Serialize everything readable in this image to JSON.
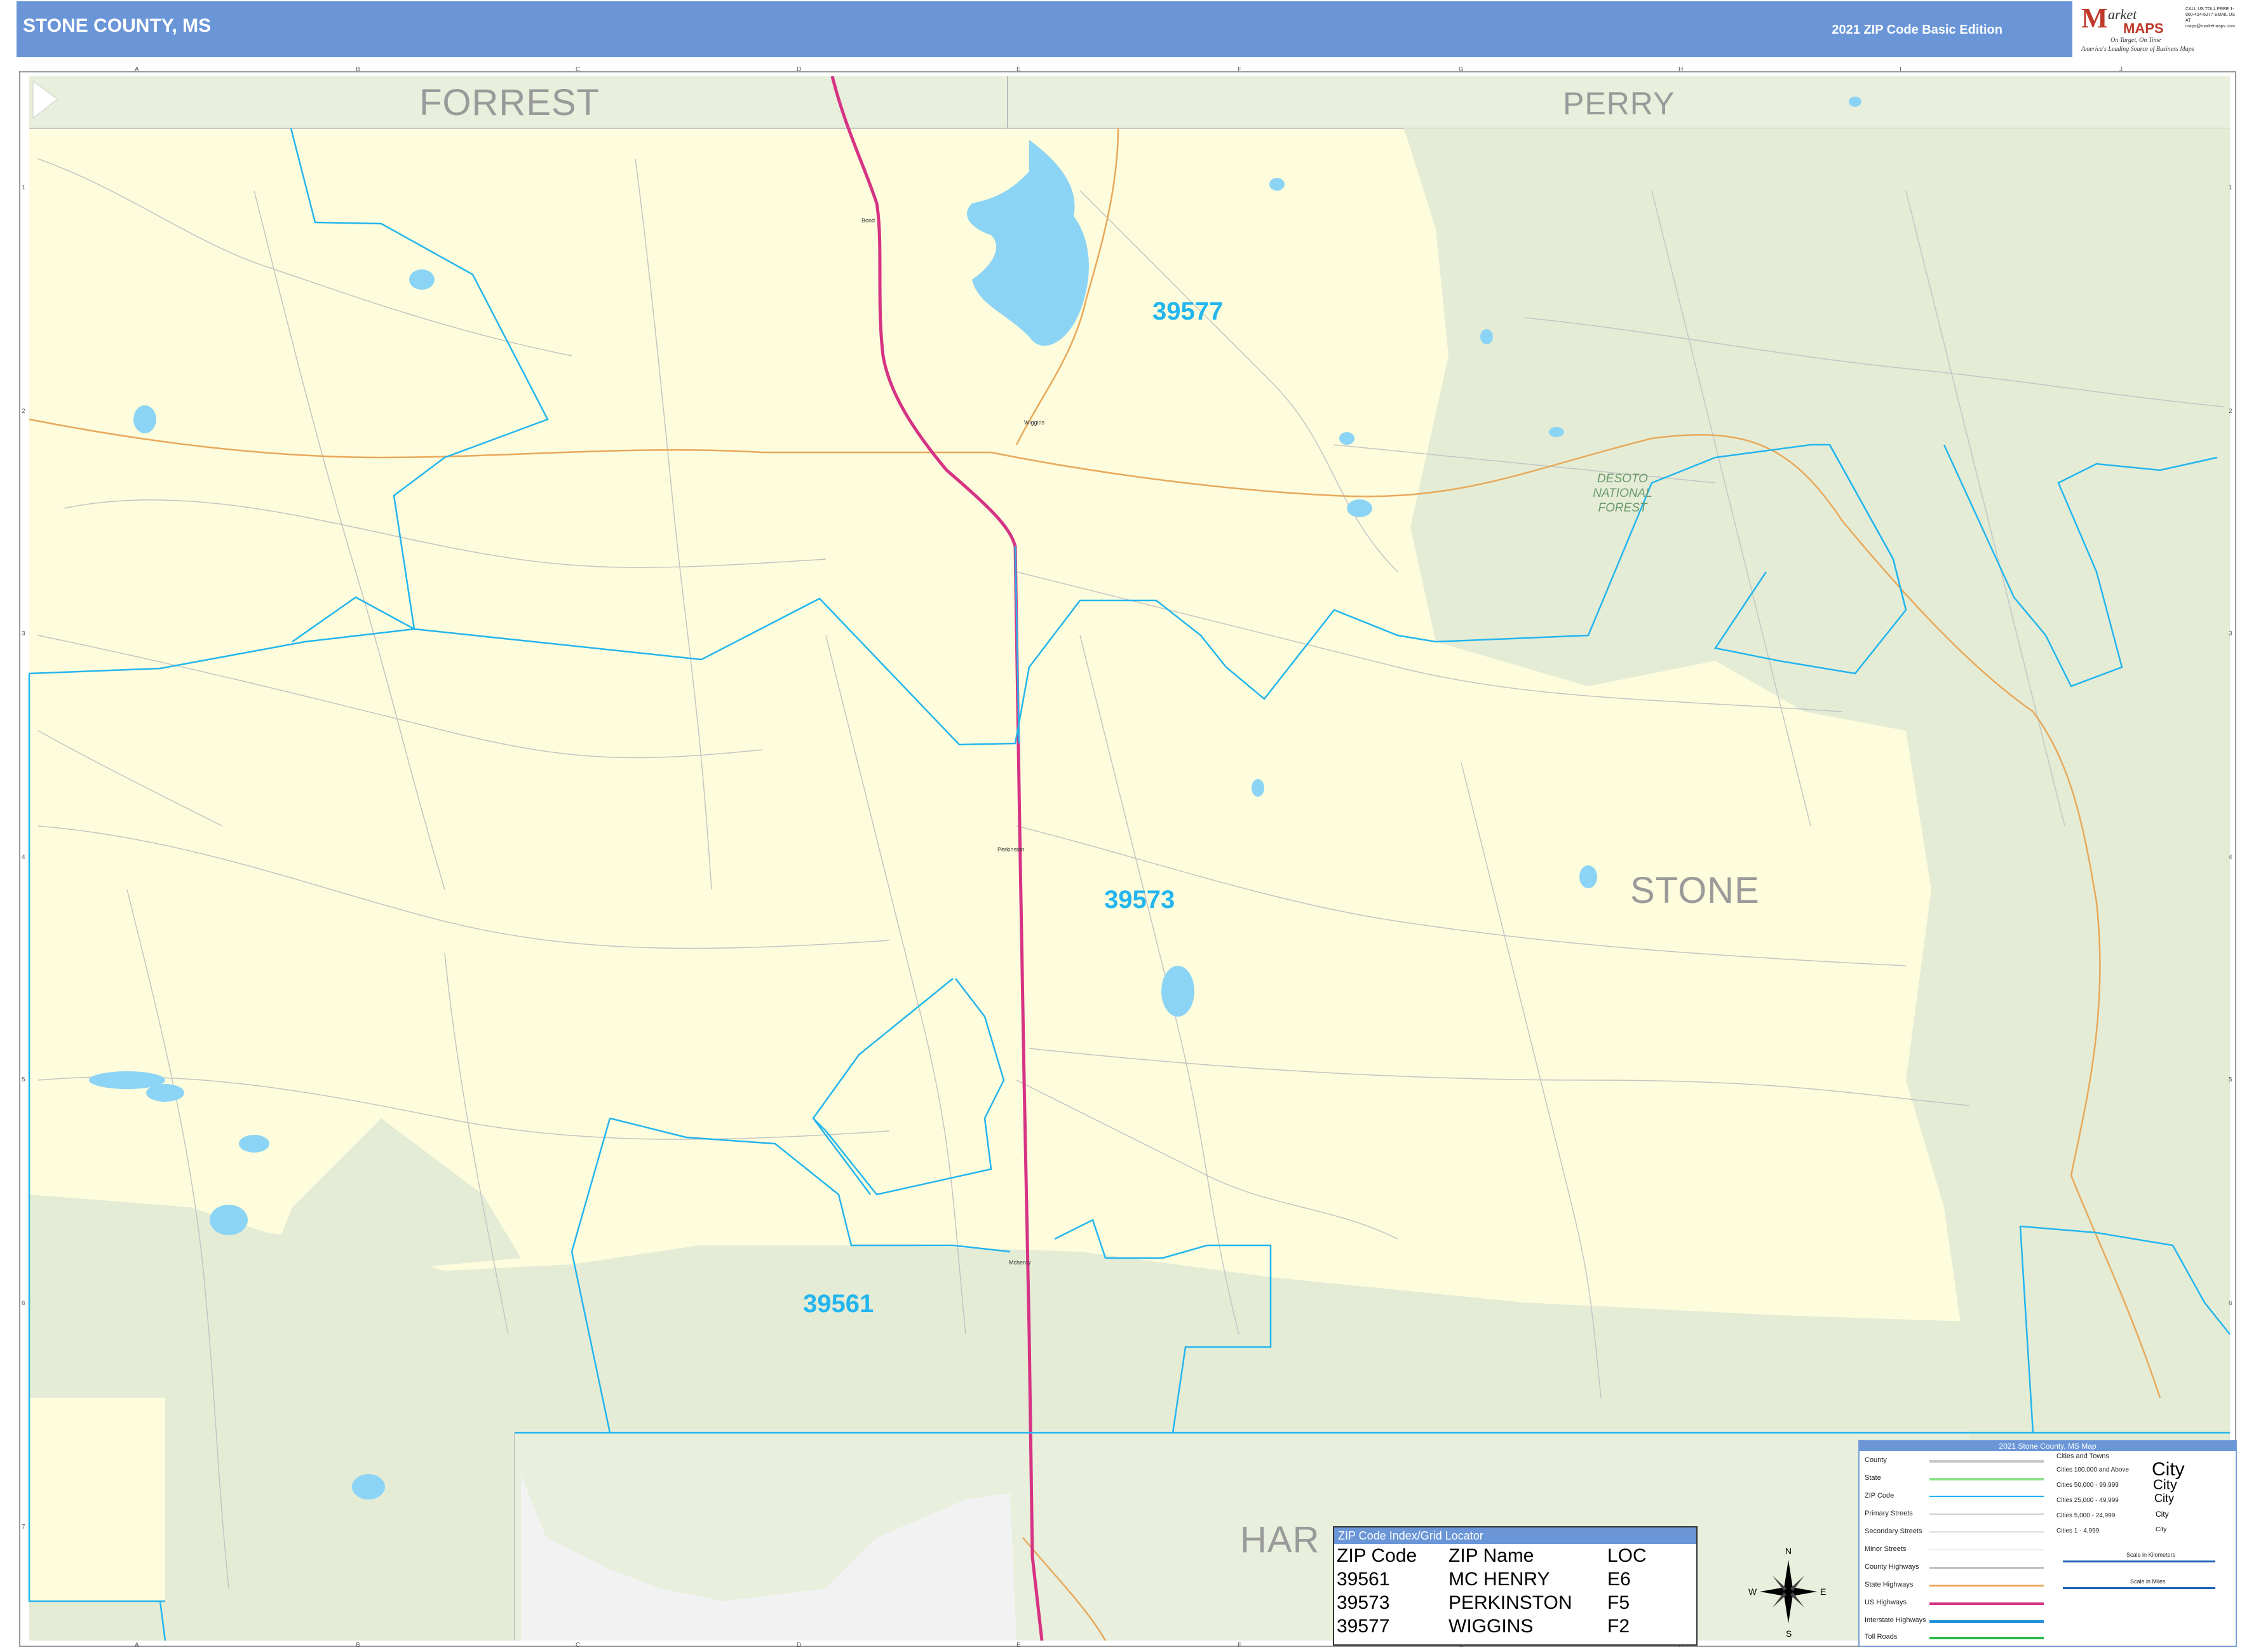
{
  "header": {
    "title": "STONE COUNTY, MS",
    "edition": "2021 ZIP Code Basic Edition"
  },
  "logo": {
    "m": "M",
    "arket": "arket",
    "maps": "MAPS",
    "tagline1": "On Target, On Time",
    "tagline2": "America's Leading Source of Business Maps",
    "contact": "CALL US TOLL FREE 1-800-424-6277 EMAIL US AT maps@marketmaps.com"
  },
  "grid": {
    "letters": [
      "A",
      "B",
      "C",
      "D",
      "E",
      "F",
      "G",
      "H",
      "I",
      "J"
    ],
    "numbers": [
      "1",
      "2",
      "3",
      "4",
      "5",
      "6",
      "7"
    ]
  },
  "counties": {
    "forrest": "FORREST",
    "perry": "PERRY",
    "stone": "STONE",
    "harrison_partial": "HAR"
  },
  "zip_labels": {
    "z39577": "39577",
    "z39573": "39573",
    "z39561": "39561"
  },
  "forest": {
    "line1": "DESOTO",
    "line2": "NATIONAL",
    "line3": "FOREST"
  },
  "towns": {
    "wiggins": "Wiggins",
    "perkinston": "Perkinston",
    "mchenry": "Mchenry",
    "bond": "Bond"
  },
  "zip_index": {
    "title": "ZIP Code Index/Grid Locator",
    "columns": [
      "ZIP Code",
      "ZIP Name",
      "LOC"
    ],
    "rows": [
      [
        "39561",
        "MC HENRY",
        "E6"
      ],
      [
        "39573",
        "PERKINSTON",
        "F5"
      ],
      [
        "39577",
        "WIGGINS",
        "F2"
      ]
    ]
  },
  "legend": {
    "title": "2021 Stone County, MS Map",
    "lines": [
      {
        "label": "County",
        "color": "#c8c8c8"
      },
      {
        "label": "State",
        "color": "#8be08b"
      },
      {
        "label": "ZIP Code",
        "color": "#23b5ee"
      },
      {
        "label": "Primary Streets",
        "color": "#d0d0d0"
      },
      {
        "label": "Secondary Streets",
        "color": "#dddddd"
      },
      {
        "label": "Minor Streets",
        "color": "#eeeeee"
      },
      {
        "label": "County Highways",
        "color": "#c0c0c0"
      },
      {
        "label": "State Highways",
        "color": "#e8a85a"
      },
      {
        "label": "US Highways",
        "color": "#d63384"
      },
      {
        "label": "Interstate Highways",
        "color": "#1a8cd8"
      },
      {
        "label": "Toll Roads",
        "color": "#2bb84a"
      }
    ],
    "cities_title": "Cities and Towns",
    "cities": [
      "Cities 100,000 and Above",
      "Cities 50,000 - 99,999",
      "Cities 25,000 - 49,999",
      "Cities 5,000 - 24,999",
      "Cities 1 - 4,999"
    ],
    "city_word": "City",
    "scale_km": "Scale in Kilometers",
    "scale_mi": "Scale in Miles"
  },
  "compass": {
    "n": "N",
    "s": "S",
    "e": "E",
    "w": "W"
  },
  "colors": {
    "header": "#6a96d8",
    "stone_fill": "#fdfcdc",
    "forest_fill": "#e4ecd6",
    "neighbor_fill": "#e8efdc",
    "zip_line": "#23b5ee",
    "us_highway": "#d63384",
    "state_highway": "#e8a85a",
    "water": "#8cd4f5"
  }
}
